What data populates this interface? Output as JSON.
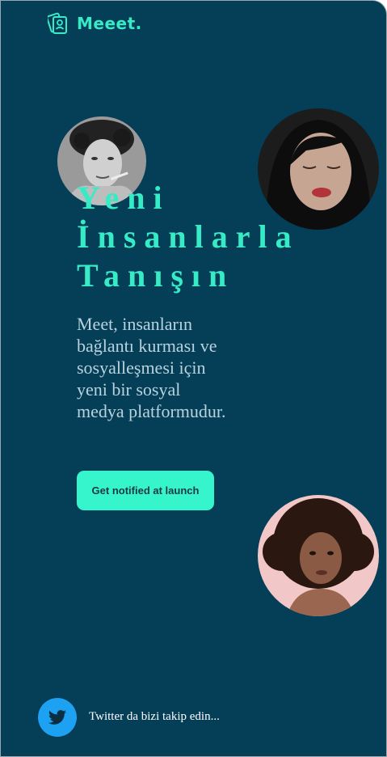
{
  "brand": {
    "name": "Meeet.",
    "logo_icon": "id-card-icon",
    "accent_color": "#36ebc6"
  },
  "hero": {
    "headline_lines": [
      "Yeni",
      "İnsanlarla",
      "Tanışın"
    ],
    "description": "Meet, insanların bağlantı kurması ve sosyalleşmesi için yeni bir sosyal medya platformudur.",
    "cta_label": "Get notified at launch"
  },
  "avatars": [
    {
      "style": "grayscale-portrait"
    },
    {
      "style": "dark-portrait"
    },
    {
      "style": "pink-portrait"
    }
  ],
  "social": {
    "icon": "twitter-bird-icon",
    "text": "Twitter da bizi takip edin..."
  },
  "colors": {
    "background": "#043e57",
    "accent": "#36ebc6",
    "button": "#36f4cb",
    "twitter": "#1da1f2"
  }
}
